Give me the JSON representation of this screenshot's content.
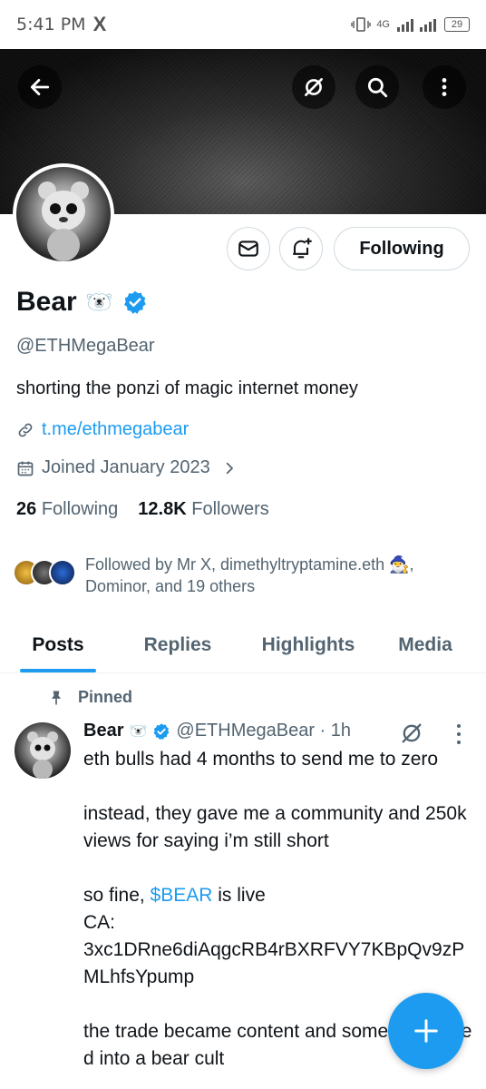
{
  "status_bar": {
    "time": "5:41 PM",
    "app_icon": "X",
    "network": "4G",
    "battery": "29"
  },
  "header": {
    "back_icon": "arrow-left-icon",
    "grok_icon": "grok-icon",
    "search_icon": "search-icon",
    "more_icon": "more-vertical-icon"
  },
  "profile": {
    "name": "Bear",
    "name_emoji": "🐻‍❄️",
    "handle": "@ETHMegaBear",
    "bio": "shorting the ponzi of magic internet money",
    "link": "t.me/ethmegabear",
    "joined": "Joined January 2023",
    "following_count": "26",
    "following_label": "Following",
    "followers_count": "12.8K",
    "followers_label": "Followers",
    "follow_button": "Following",
    "followed_by_line1": "Followed by Mr X, dimethyltryptamine.eth 🧙‍♂️,",
    "followed_by_line2": "Dominor, and 19 others"
  },
  "tabs": [
    {
      "label": "Posts",
      "active": true
    },
    {
      "label": "Replies",
      "active": false
    },
    {
      "label": "Highlights",
      "active": false
    },
    {
      "label": "Media",
      "active": false
    }
  ],
  "post": {
    "pinned_label": "Pinned",
    "author": "Bear",
    "author_emoji": "🐻‍❄️",
    "handle_time": "@ETHMegaBear · 1h",
    "text_1": "eth bulls had 4 months to send me to zero\n\ninstead, they gave me a community and 250k views for saying i’m still short\n\nso fine, ",
    "cashtag": "$BEAR",
    "text_2": " is live\nCA:\n3xc1DRne6diAqgcRB4rBXRFVY7KBpQv9zPMLhfsYpump\n\nthe trade became content and somehow turned into a bear cult"
  },
  "colors": {
    "accent": "#1d9bf0",
    "secondary_text": "#536471",
    "primary_text": "#0f1419"
  }
}
